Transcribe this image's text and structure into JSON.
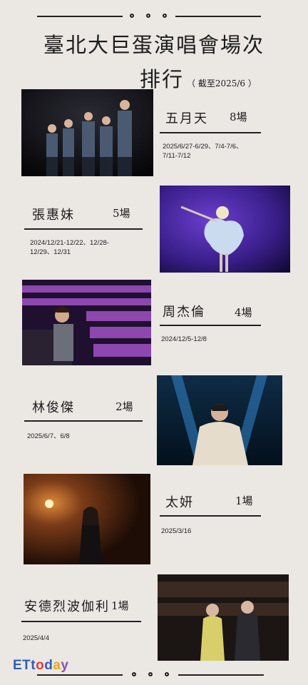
{
  "title": {
    "line1": "臺北大巨蛋演唱會場次",
    "line2": "排行",
    "note": "（ 截至2025/6 ）"
  },
  "entries": [
    {
      "name": "五月天",
      "count": "8場",
      "dates": "2025/6/27-6/29、7/4-7/6、\n7/11-7/12"
    },
    {
      "name": "張惠妹",
      "count": "5場",
      "dates": "2024/12/21-12/22、12/28-\n12/29、12/31"
    },
    {
      "name": "周杰倫",
      "count": "4場",
      "dates": "2024/12/5-12/8"
    },
    {
      "name": "林俊傑",
      "count": "2場",
      "dates": "2025/6/7、6/8"
    },
    {
      "name": "太妍",
      "count": "1場",
      "dates": "2025/3/16"
    },
    {
      "name": "安德烈波伽利",
      "count": "1場",
      "dates": "2025/4/4"
    }
  ],
  "logo": {
    "text": "ETtoday",
    "colors": {
      "E": "#2f5fb3",
      "T": "#2f5fb3",
      "t": "#e8383d",
      "o": "#f2a516",
      "d": "#2f9d4b",
      "a": "#2f5fb3",
      "y": "#8c4fb8"
    }
  }
}
